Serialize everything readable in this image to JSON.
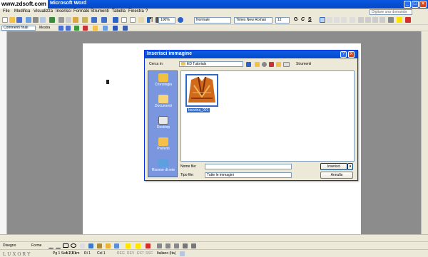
{
  "app": {
    "watermark": "www.zdsoft.com",
    "title": "Microsoft Word",
    "help_placeholder": "Digitare una domanda"
  },
  "menubar": {
    "items": [
      "File",
      "Modifica",
      "Visualizza",
      "Inserisci",
      "Formato",
      "Strumenti",
      "Tabella",
      "Finestra",
      "?"
    ]
  },
  "toolbar": {
    "zoom": "100%",
    "style": "Normale",
    "font": "Times New Roman",
    "font_size": "12",
    "bold": "G",
    "italic": "C",
    "underline": "S"
  },
  "reviewbar": {
    "view": "Commenti finali",
    "show": "Mostra"
  },
  "dialog": {
    "title": "Inserisci immagine",
    "look_in_label": "Cerca in:",
    "look_in_value": "ED Tutorials",
    "tools_label": "Strumenti",
    "places": [
      "Cronologia",
      "Documenti",
      "Desktop",
      "Preferiti",
      "Risorse di rete"
    ],
    "file_label": "bozzina_001",
    "filename_label": "Nome file:",
    "filename_value": "",
    "filetype_label": "Tipo file:",
    "filetype_value": "Tutte le immagini",
    "insert_button": "Inserisci",
    "cancel_button": "Annulla",
    "help": "?",
    "close": "X"
  },
  "drawbar": {
    "draw": "Disegno",
    "shapes": "Forme"
  },
  "statusbar": {
    "page": "Pg 1",
    "section": "Sez 1",
    "pages": "1/1",
    "position": "A 2,5 cm",
    "line": "Ri 1",
    "column": "Col 1",
    "flags": [
      "REG",
      "REV",
      "EST",
      "SSC"
    ],
    "language": "Italiano (Ita)"
  },
  "colors": {
    "titlebar": "#0a58e0",
    "places_panel": "#7a96df",
    "selection": "#316ac5"
  }
}
